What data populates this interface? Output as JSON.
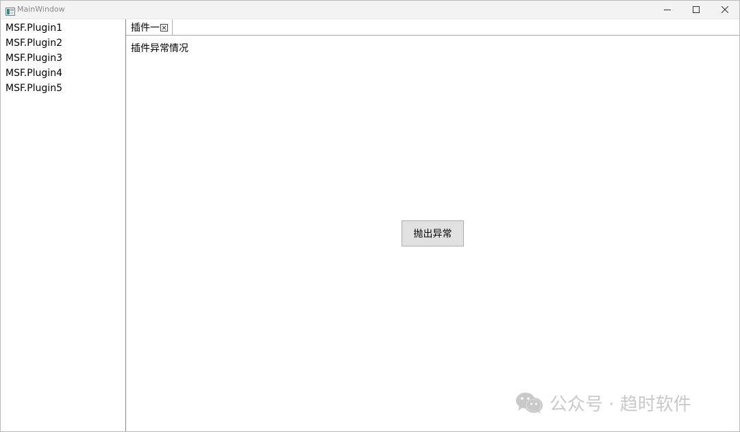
{
  "window": {
    "title": "MainWindow"
  },
  "sidebar": {
    "items": [
      {
        "label": "MSF.Plugin1"
      },
      {
        "label": "MSF.Plugin2"
      },
      {
        "label": "MSF.Plugin3"
      },
      {
        "label": "MSF.Plugin4"
      },
      {
        "label": "MSF.Plugin5"
      }
    ]
  },
  "tabs": [
    {
      "label": "插件一",
      "close_glyph": "⊠"
    }
  ],
  "main": {
    "heading": "插件异常情况",
    "throw_button_label": "抛出异常"
  },
  "watermark": {
    "text": "公众号 · 趋时软件",
    "icon": "wechat-icon"
  },
  "colors": {
    "titlebar_bg": "#f3f3f3",
    "button_bg": "#e1e1e1",
    "button_border": "#adadad",
    "divider": "#828790",
    "watermark": "#c9c9c9"
  }
}
